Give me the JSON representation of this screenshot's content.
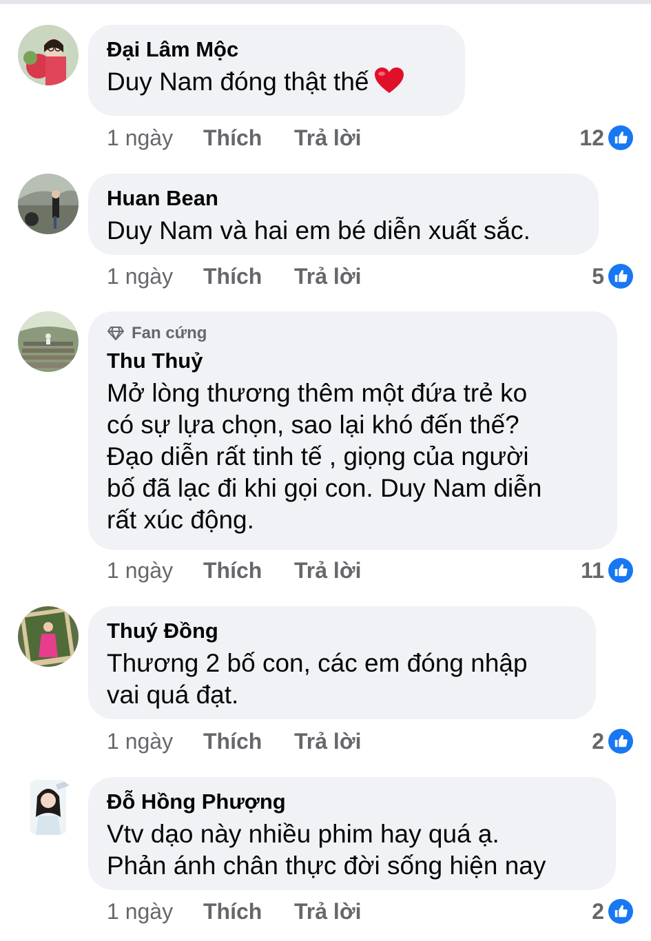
{
  "colors": {
    "accent": "#1877f2",
    "bubble": "#f0f2f5",
    "meta": "#65676b",
    "heart": "#e0102a"
  },
  "comments": [
    {
      "author": "Đại Lâm Mộc",
      "text": "Duy Nam đóng thật thế",
      "emoji": "heart-emoji",
      "time": "1 ngày",
      "like": "Thích",
      "reply": "Trả lời",
      "reactions": "12"
    },
    {
      "author": "Huan Bean",
      "text": "Duy Nam và hai em bé diễn xuất sắc.",
      "time": "1 ngày",
      "like": "Thích",
      "reply": "Trả lời",
      "reactions": "5"
    },
    {
      "badge": "Fan cứng",
      "author": "Thu Thuỷ",
      "text_lines": [
        "Mở lòng thương thêm một đứa trẻ ko",
        "có sự lựa chọn, sao lại khó đến thế?",
        "Đạo diễn rất tinh tế , giọng của người",
        "bố đã lạc đi khi gọi con. Duy Nam diễn",
        "rất xúc động."
      ],
      "time": "1 ngày",
      "like": "Thích",
      "reply": "Trả lời",
      "reactions": "11"
    },
    {
      "author": "Thuý Đồng",
      "text_lines": [
        "Thương 2 bố con, các em đóng nhập",
        "vai quá đạt."
      ],
      "time": "1 ngày",
      "like": "Thích",
      "reply": "Trả lời",
      "reactions": "2"
    },
    {
      "author": "Đỗ Hồng Phượng",
      "text_lines": [
        "Vtv dạo này nhiều phim hay quá ạ.",
        "Phản ánh chân thực đời sống hiện nay"
      ],
      "time": "1 ngày",
      "like": "Thích",
      "reply": "Trả lời",
      "reactions": "2"
    }
  ]
}
